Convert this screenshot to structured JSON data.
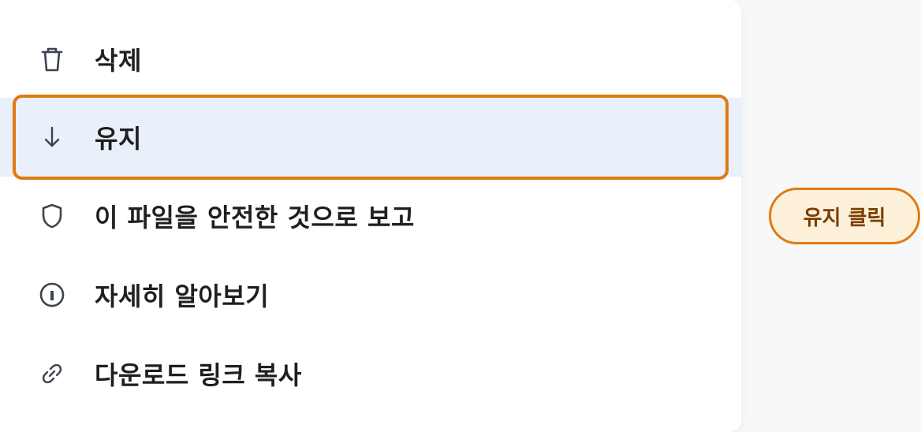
{
  "menu": {
    "items": [
      {
        "label": "삭제",
        "icon": "trash-icon"
      },
      {
        "label": "유지",
        "icon": "arrow-down-icon"
      },
      {
        "label": "이 파일을 안전한 것으로 보고",
        "icon": "shield-icon"
      },
      {
        "label": "자세히 알아보기",
        "icon": "info-icon"
      },
      {
        "label": "다운로드 링크 복사",
        "icon": "link-icon"
      }
    ]
  },
  "annotation": {
    "label": "유지 클릭"
  },
  "colors": {
    "highlight": "#e07a10",
    "selected_bg": "#e9f0fa",
    "badge_bg": "#fdf0d9",
    "text": "#1f1f1f",
    "icon": "#3c4450"
  }
}
